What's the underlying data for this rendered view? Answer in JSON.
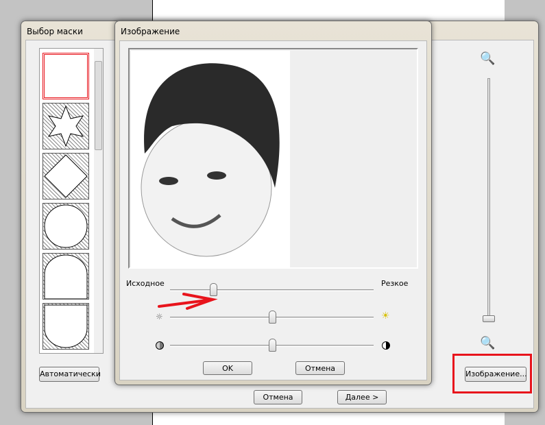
{
  "mask_window": {
    "title": "Выбор маски",
    "auto_button": "Автоматически",
    "cancel_button": "Отмена",
    "next_button": "Далее >",
    "image_button": "Изображение..."
  },
  "image_dialog": {
    "title": "Изображение",
    "slider_sharpness": {
      "left_label": "Исходное",
      "right_label": "Резкое",
      "value_percent": 22
    },
    "slider_brightness": {
      "value_percent": 50
    },
    "slider_contrast": {
      "value_percent": 50
    },
    "ok_button": "OK",
    "cancel_button": "Отмена"
  },
  "zoom_slider": {
    "value_percent": 0
  },
  "colors": {
    "highlight": "#e8141c"
  }
}
